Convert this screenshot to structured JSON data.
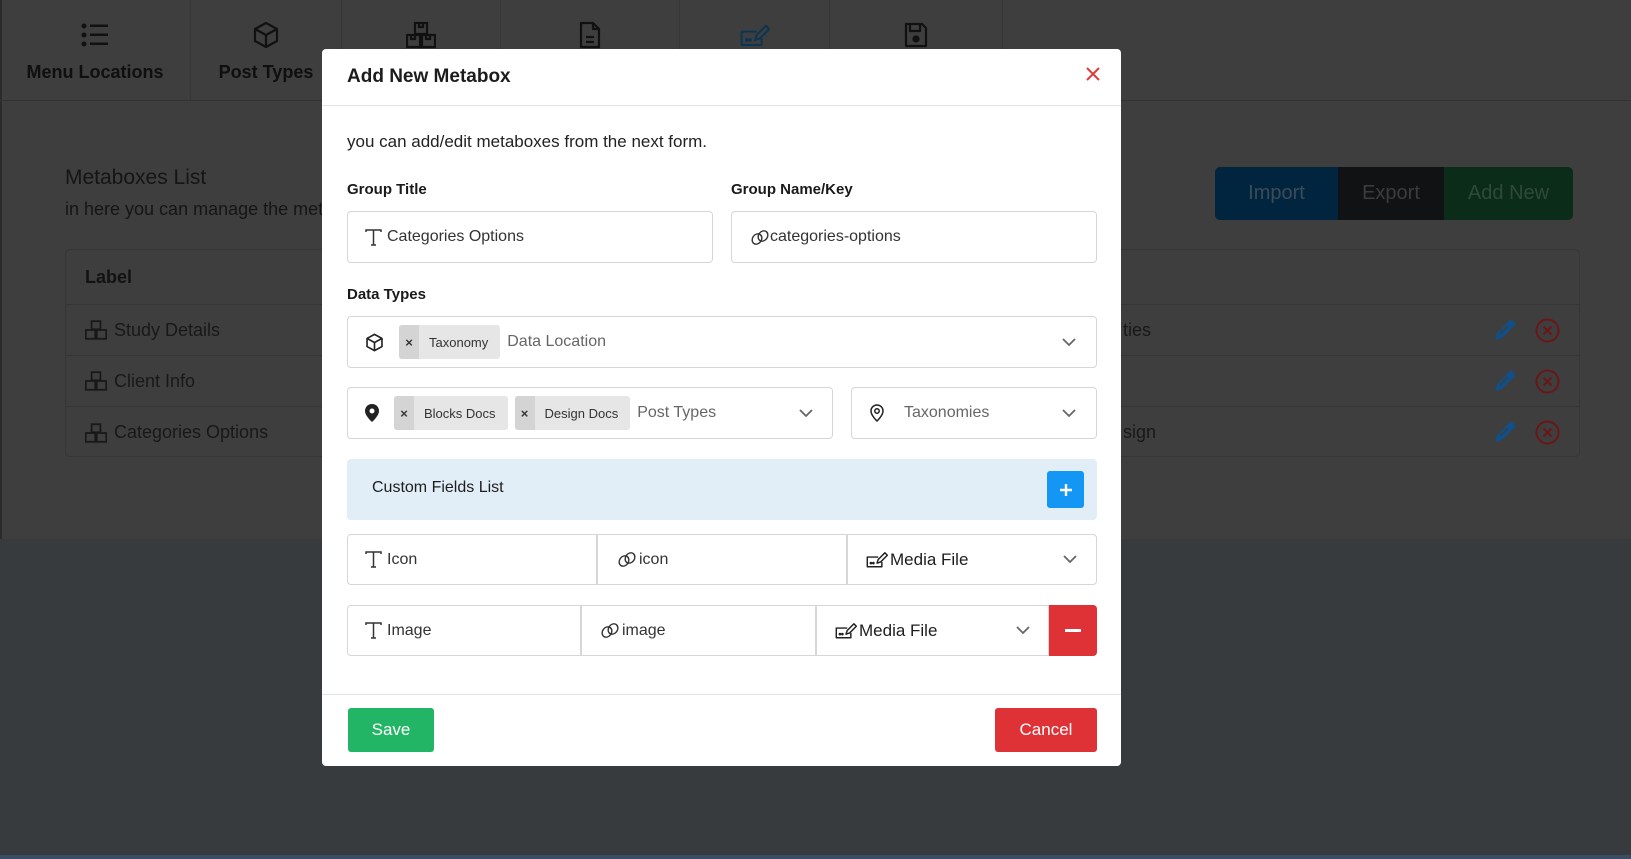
{
  "tabs": [
    {
      "label": "Menu Locations",
      "icon": "list-icon"
    },
    {
      "label": "Post Types",
      "icon": "cube-icon"
    },
    {
      "label": "",
      "icon": "boxes-icon"
    },
    {
      "label": "",
      "icon": "file-icon"
    },
    {
      "label": "",
      "icon": "signature-edit-icon"
    },
    {
      "label": "",
      "icon": "floppy-disk-icon"
    }
  ],
  "background": {
    "list_title": "Metaboxes List",
    "list_subtitle": "in here you can manage the meta",
    "buttons": {
      "import": "Import",
      "export": "Export",
      "add_new": "Add New"
    },
    "table": {
      "header_label": "Label",
      "rows": [
        {
          "label": "Study Details",
          "middle": "ties"
        },
        {
          "label": "Client Info",
          "middle": ""
        },
        {
          "label": "Categories Options",
          "middle": "sign"
        }
      ]
    }
  },
  "modal": {
    "title": "Add New Metabox",
    "intro": "you can add/edit metaboxes from the next form.",
    "group_title": {
      "label": "Group Title",
      "value": "Categories Options"
    },
    "group_key": {
      "label": "Group Name/Key",
      "value": "categories-options"
    },
    "data_types": {
      "label": "Data Types",
      "location_chips": [
        "Taxonomy"
      ],
      "location_placeholder": "Data Location",
      "post_type_chips": [
        "Blocks Docs",
        "Design Docs"
      ],
      "post_types_placeholder": "Post Types",
      "taxonomies_placeholder": "Taxonomies"
    },
    "custom_fields": {
      "title": "Custom Fields List",
      "rows": [
        {
          "label": "Icon",
          "key": "icon",
          "type": "Media File"
        },
        {
          "label": "Image",
          "key": "image",
          "type": "Media File"
        }
      ]
    },
    "save_label": "Save",
    "cancel_label": "Cancel"
  },
  "colors": {
    "save": "#23b566",
    "cancel": "#df3236",
    "add_field": "#1496f5",
    "custom_fields_header": "#e1edf7",
    "close_icon": "#e03b3b"
  }
}
